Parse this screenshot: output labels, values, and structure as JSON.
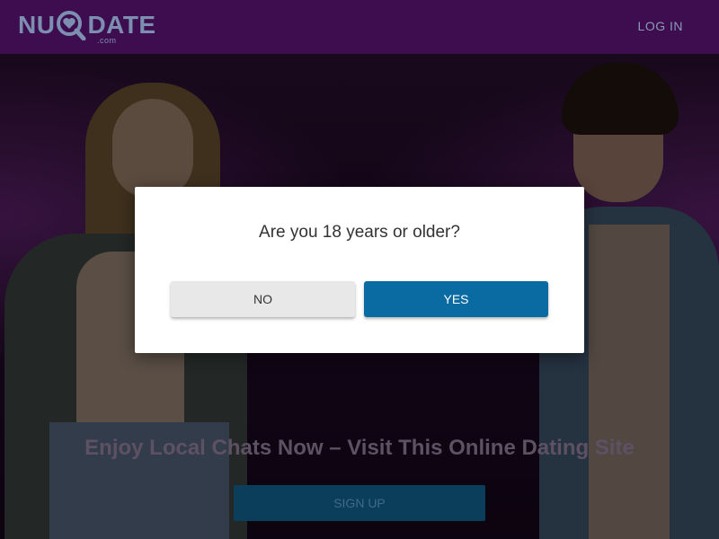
{
  "header": {
    "logo_text_left": "NU",
    "logo_text_right": "DATE",
    "logo_suffix": ".com",
    "login_label": "LOG IN"
  },
  "hero": {
    "tagline": "Enjoy Local Chats Now – Visit This Online Dating Site",
    "signup_label": "SIGN UP"
  },
  "modal": {
    "question": "Are you 18 years or older?",
    "no_label": "NO",
    "yes_label": "YES"
  },
  "colors": {
    "header_bg": "#3d0d4f",
    "yes_button": "#0a6aa2",
    "no_button": "#e8e8e8",
    "logo": "#7d8fb0"
  }
}
